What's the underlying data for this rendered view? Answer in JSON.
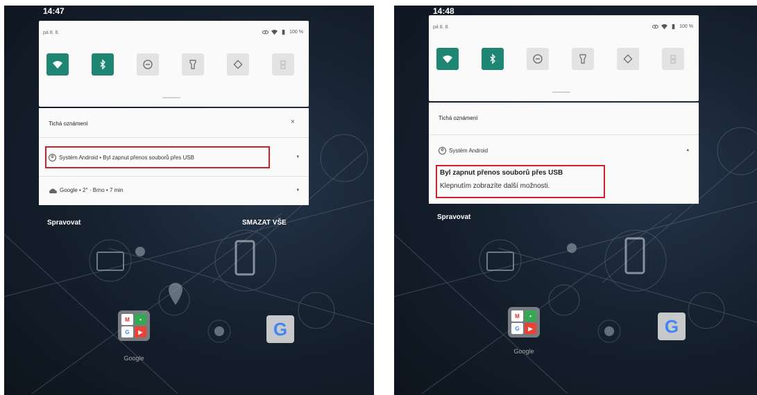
{
  "left": {
    "clock": "14:47",
    "date": "pá 8. 8.",
    "battery": "100 %",
    "notification_header": "Tichá oznámení",
    "dismiss_glyph": "×",
    "android_row": "Systém Android • Byl zapnut přenos souborů přes USB",
    "google_row": "Google • 2° · Brno • 7 min",
    "manage": "Spravovat",
    "clear_all": "SMAZAT VŠE",
    "home_label": "Google"
  },
  "right": {
    "clock": "14:48",
    "date": "pá 8. 8.",
    "battery": "100 %",
    "notification_header": "Tichá oznámení",
    "android_app": "Systém Android",
    "notif_title": "Byl zapnut přenos souborů přes USB",
    "notif_body": "Klepnutím zobrazíte další možnosti.",
    "manage": "Spravovat",
    "home_label": "Google"
  },
  "tiles": [
    {
      "name": "wifi",
      "active": true
    },
    {
      "name": "bluetooth",
      "active": true
    },
    {
      "name": "do-not-disturb",
      "active": false
    },
    {
      "name": "flashlight",
      "active": false
    },
    {
      "name": "auto-rotate",
      "active": false
    },
    {
      "name": "battery-saver",
      "active": false
    }
  ],
  "colors": {
    "tile_active": "#1f8674",
    "highlight": "#d01f2b",
    "panel": "#fafafa"
  }
}
